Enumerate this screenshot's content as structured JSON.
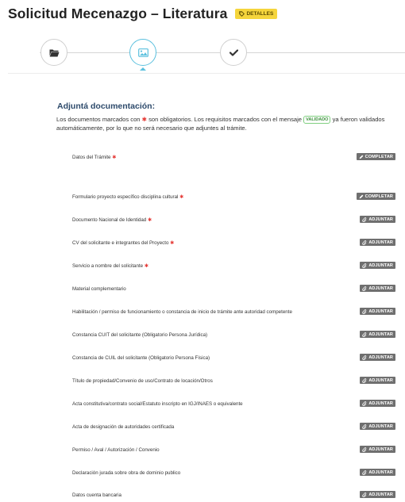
{
  "header": {
    "title": "Solicitud Mecenazgo – Literatura",
    "badge_label": "DETALLES",
    "badge_icon": "tag-icon",
    "badge_color": "#f5d53c"
  },
  "steps": [
    {
      "icon": "folder-icon",
      "state": "done"
    },
    {
      "icon": "image-icon",
      "state": "active"
    },
    {
      "icon": "check-icon",
      "state": "pending"
    }
  ],
  "section": {
    "heading": "Adjuntá documentación:",
    "intro_part1": "Los documentos marcados con ",
    "intro_star": "✱",
    "intro_part2": " son obligatorios. Los requisitos marcados con el mensaje ",
    "validado_label": "VALIDADO",
    "intro_part3": " ya fueron validados automáticamente, por lo que no será necesario que adjuntes al trámite."
  },
  "documents": [
    {
      "label": "Datos del Trámite",
      "required": true,
      "action": "COMPLETAR",
      "action_icon": "pencil-icon"
    },
    {
      "label": "Formulario proyecto específico disciplina cultural",
      "required": true,
      "action": "COMPLETAR",
      "action_icon": "pencil-icon"
    },
    {
      "label": "Documento Nacional de Identidad",
      "required": true,
      "action": "ADJUNTAR",
      "action_icon": "paperclip-icon"
    },
    {
      "label": "CV del solicitante e integrantes del Proyecto",
      "required": true,
      "action": "ADJUNTAR",
      "action_icon": "paperclip-icon"
    },
    {
      "label": "Servicio a nombre del solicitante",
      "required": true,
      "action": "ADJUNTAR",
      "action_icon": "paperclip-icon"
    },
    {
      "label": "Material complementario",
      "required": false,
      "action": "ADJUNTAR",
      "action_icon": "paperclip-icon"
    },
    {
      "label": "Habilitación / permiso de funcionamiento o constancia de inicio de trámite ante autoridad competente",
      "required": false,
      "action": "ADJUNTAR",
      "action_icon": "paperclip-icon"
    },
    {
      "label": "Constancia CUIT del solicitante (Obligatorio Persona Jurídica)",
      "required": false,
      "action": "ADJUNTAR",
      "action_icon": "paperclip-icon"
    },
    {
      "label": "Constancia de CUIL del solicitante (Obligatorio Persona Física)",
      "required": false,
      "action": "ADJUNTAR",
      "action_icon": "paperclip-icon"
    },
    {
      "label": "Título de propiedad/Convenio de uso/Contrato de locación/Otros",
      "required": false,
      "action": "ADJUNTAR",
      "action_icon": "paperclip-icon"
    },
    {
      "label": "Acta constitutiva/contrato social/Estatuto inscripto en IGJ/INAES o equivalente",
      "required": false,
      "action": "ADJUNTAR",
      "action_icon": "paperclip-icon"
    },
    {
      "label": "Acta de designación de autoridades certificada",
      "required": false,
      "action": "ADJUNTAR",
      "action_icon": "paperclip-icon"
    },
    {
      "label": "Permiso / Aval / Autorización / Convenio",
      "required": false,
      "action": "ADJUNTAR",
      "action_icon": "paperclip-icon"
    },
    {
      "label": "Declaración jurada sobre obra de dominio publico",
      "required": false,
      "action": "ADJUNTAR",
      "action_icon": "paperclip-icon"
    },
    {
      "label": "Datos cuenta bancaria",
      "required": false,
      "action": "ADJUNTAR",
      "action_icon": "paperclip-icon"
    }
  ],
  "colors": {
    "accent": "#5bc0de",
    "required_star": "#e53935",
    "validado": "#3b8f3b",
    "button_bg": "#6f6f6f",
    "heading": "#2d4a6b"
  }
}
